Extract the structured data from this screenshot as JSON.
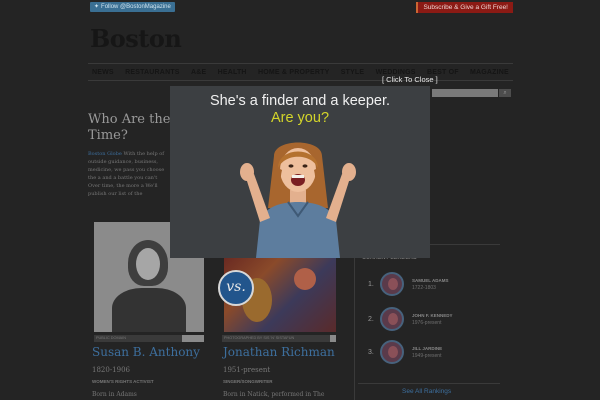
{
  "header": {
    "twitter_label": "Follow @BostonMagazine",
    "subscribe_label": "Subscribe & Give a Gift Free!",
    "logo_text": "Boston"
  },
  "nav": {
    "items": [
      "NEWS",
      "RESTAURANTS",
      "A&E",
      "HEALTH",
      "HOME & PROPERTY",
      "STYLE",
      "WEDDINGS",
      "BEST OF",
      "MAGAZINE"
    ]
  },
  "search": {
    "button_icon": "search-icon"
  },
  "article": {
    "headline": "Who Are the Time?",
    "intro_link": "Boston Globe",
    "intro_text": "With the help of outside guidance, business, medicine, we pass you choose the a and a battle you can't Over time, the more a We'll publish our list of the"
  },
  "matchup": {
    "vs_label": "vs.",
    "left": {
      "caption": "PUBLIC DOMAIN",
      "name": "Susan B. Anthony",
      "years": "1820-1906",
      "role": "WOMEN'S RIGHTS ACTIVIST",
      "born": "Born in Adams"
    },
    "right": {
      "caption": "PHOTOGRAPHED BY SIS 'N' SISTAFUN",
      "name": "Jonathan Richman",
      "years": "1951-present",
      "role": "SINGER/SONGWRITER",
      "born": "Born in Natick, performed in The"
    }
  },
  "sidebar": {
    "label": "CURRENT LEADERS",
    "leaders": [
      {
        "rank": "1.",
        "name": "SAMUEL ADAMS",
        "years": "1722-1803"
      },
      {
        "rank": "2.",
        "name": "JOHN F. KENNEDY",
        "years": "1976-present"
      },
      {
        "rank": "3.",
        "name": "JILL JARDINE",
        "years": "1949-present"
      }
    ],
    "see_all": "See All Rankings"
  },
  "modal": {
    "close_label": "[ Click To Close ]",
    "title": "She's a finder and a keeper.",
    "subtitle": "Are you?",
    "title_color": "#f0f0f0",
    "subtitle_color": "#d3d52a"
  }
}
